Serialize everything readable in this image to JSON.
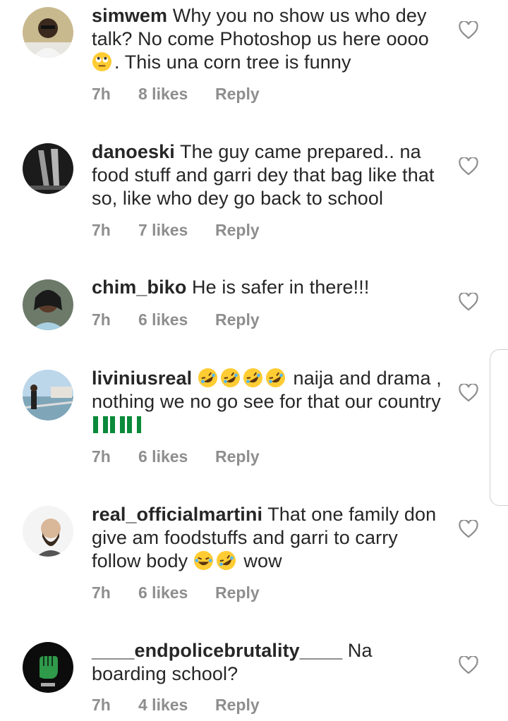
{
  "comments": [
    {
      "username": "simwem",
      "text1": "Why you no show us who dey talk? No come Photoshop us here oooo",
      "text2": ". This una corn tree is funny",
      "time": "7h",
      "likes": "8 likes",
      "reply": "Reply"
    },
    {
      "username": "danoeski",
      "text1": "The guy came prepared.. na food stuff and garri dey that bag like that so, like who dey go back to school",
      "time": "7h",
      "likes": "7 likes",
      "reply": "Reply"
    },
    {
      "username": "chim_biko",
      "text1": "He is safer in there!!!",
      "time": "7h",
      "likes": "6 likes",
      "reply": "Reply"
    },
    {
      "username": "liviniusreal",
      "text2": "naija and drama , nothing we no go see for that our country",
      "time": "7h",
      "likes": "6 likes",
      "reply": "Reply"
    },
    {
      "username": "real_officialmartini",
      "text1": "That one family don give am foodstuffs and garri to carry follow body",
      "text2": "wow",
      "time": "7h",
      "likes": "6 likes",
      "reply": "Reply"
    },
    {
      "username": "____endpolicebrutality____",
      "text1": "Na boarding school?",
      "time": "7h",
      "likes": "4 likes",
      "reply": "Reply"
    }
  ],
  "colors": {
    "text": "#262626",
    "meta": "#8e8e8e",
    "emoji": "#ffcc33",
    "flag_green": "#0a8a3a"
  }
}
